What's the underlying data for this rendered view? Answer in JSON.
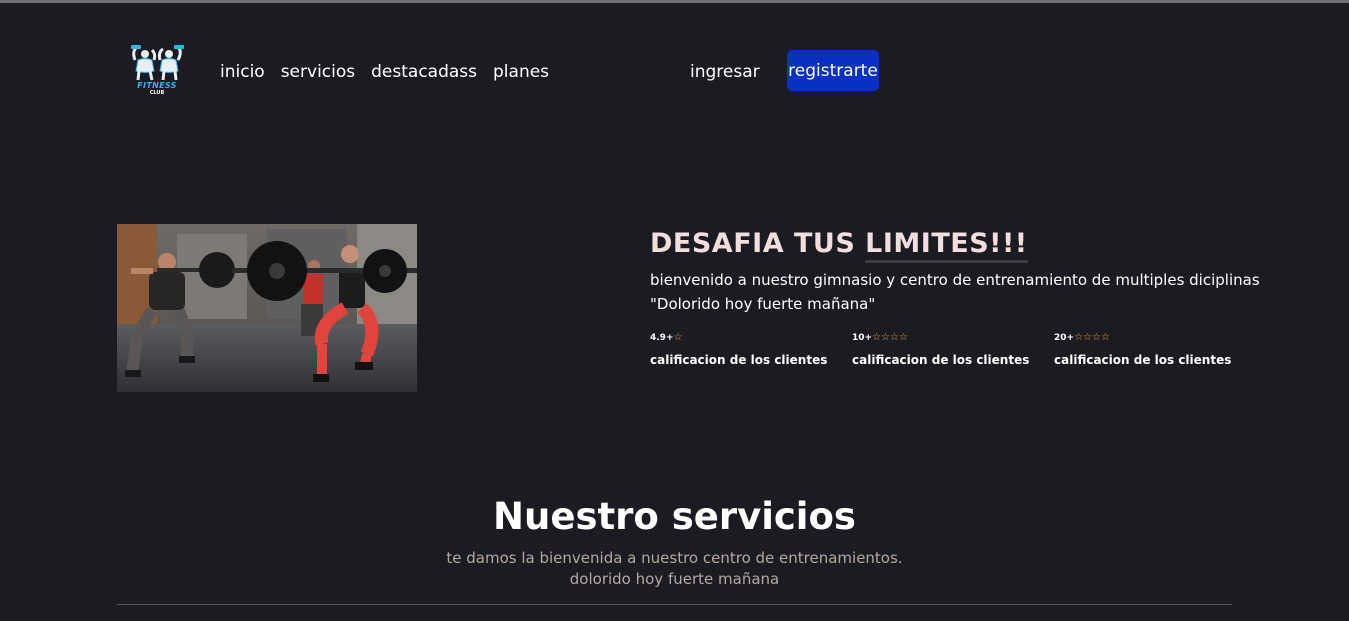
{
  "brand": {
    "logo_text": "FITNESS",
    "logo_sub": "CLUB"
  },
  "nav": {
    "items": [
      "inicio",
      "servicios",
      "destacadass",
      "planes"
    ],
    "login_label": "ingresar",
    "register_label": "registrarte"
  },
  "hero": {
    "title_part1": "DESAFIA TUS ",
    "title_part2": "LIMITES!!!",
    "line1": "bienvenido a nuestro gimnasio y centro de entrenamiento de multiples diciplinas",
    "line2": "\"Dolorido hoy fuerte mañana\"",
    "stats": [
      {
        "value": "4.9+",
        "stars": "☆",
        "label": "calificacion de los clientes"
      },
      {
        "value": "10+",
        "stars": "☆☆☆☆",
        "label": "calificacion de los clientes"
      },
      {
        "value": "20+",
        "stars": "☆☆☆☆",
        "label": "calificacion de los clientes"
      }
    ]
  },
  "services": {
    "title": "Nuestro servicios",
    "subtitle1": "te damos la bienvenida a nuestro centro de entrenamientos.",
    "subtitle2": "dolorido hoy fuerte mañana"
  },
  "colors": {
    "background": "#1b1b24",
    "accent_button": "#0a2fc4",
    "title_pink": "#f3dede",
    "star_gold": "#f2b01e",
    "logo_cyan": "#27b8e8"
  }
}
